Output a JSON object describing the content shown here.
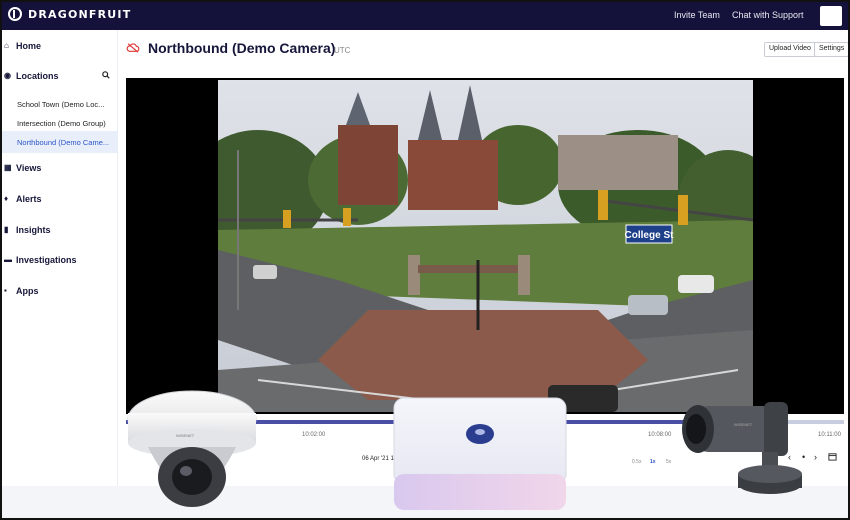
{
  "app": {
    "brand": "DRAGONFRUIT"
  },
  "topbar": {
    "invite_label": "Invite Team",
    "support_label": "Chat with Support"
  },
  "sidebar": {
    "home": "Home",
    "locations": "Locations",
    "location_items": [
      {
        "label": "School Town (Demo Loc..."
      },
      {
        "label": "Intersection (Demo Group)"
      },
      {
        "label": "Northbound (Demo Came...",
        "active": true
      }
    ],
    "views": "Views",
    "alerts": "Alerts",
    "insights": "Insights",
    "investigations": "Investigations",
    "apps": "Apps"
  },
  "header": {
    "title": "Northbound (Demo Camera)",
    "timezone": "UTC",
    "upload_label": "Upload Video",
    "settings_label": "Settings"
  },
  "video": {
    "street_sign": "College St"
  },
  "timeline": {
    "times": [
      "10:02:00",
      "10:08:00",
      "10:11:00"
    ],
    "date": "06 Apr '21 10:",
    "speeds": [
      "0.5x",
      "1x",
      "5x"
    ],
    "selected_speed": "1x",
    "progress": 0.85
  },
  "overlay_products": {
    "dome_camera_brand": "WISENET",
    "bullet_camera_brand": "WISENET"
  },
  "colors": {
    "topbar_bg": "#14123a",
    "accent": "#2a55c8",
    "active_bg": "#e9eefb",
    "timeline_fill": "#4a4fa5"
  },
  "icons": {
    "logo": "dragonfruit-logo-icon",
    "home": "home-icon",
    "locations": "location-pin-icon",
    "search": "search-icon",
    "views": "grid-icon",
    "alerts": "bell-icon",
    "insights": "chart-icon",
    "investigations": "folder-icon",
    "apps": "apps-icon",
    "camera_offline": "cloud-off-icon",
    "calendar": "calendar-icon"
  }
}
